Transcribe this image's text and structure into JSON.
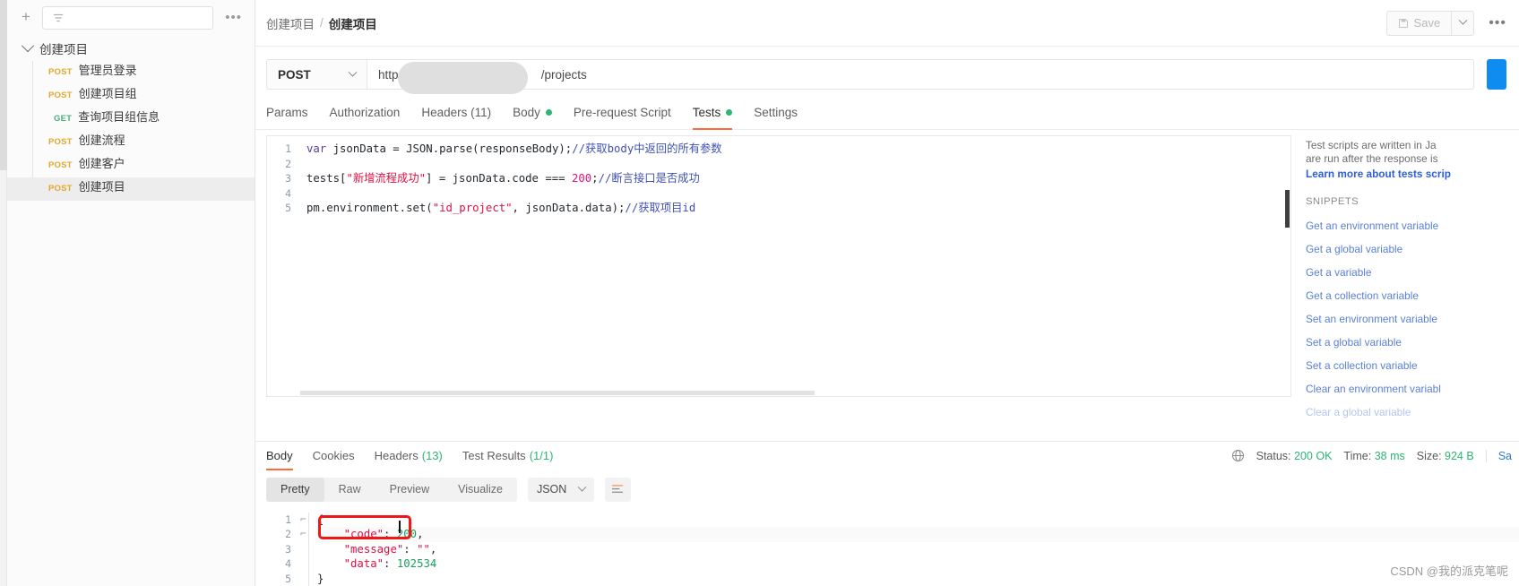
{
  "sidebar": {
    "add_label": "+",
    "filter_placeholder": "",
    "more_label": "•••",
    "collection": "创建项目",
    "requests": [
      {
        "method": "POST",
        "name": "管理员登录"
      },
      {
        "method": "POST",
        "name": "创建项目组"
      },
      {
        "method": "GET",
        "name": "查询项目组信息"
      },
      {
        "method": "POST",
        "name": "创建流程"
      },
      {
        "method": "POST",
        "name": "创建客户"
      },
      {
        "method": "POST",
        "name": "创建项目"
      }
    ]
  },
  "header": {
    "breadcrumb_parent": "创建项目",
    "breadcrumb_sep": "/",
    "breadcrumb_current": "创建项目",
    "save_label": "Save",
    "more_label": "•••"
  },
  "request": {
    "method": "POST",
    "url_prefix": "http://",
    "url_suffix": "/projects",
    "tabs": [
      {
        "label": "Params",
        "dot": false,
        "active": false
      },
      {
        "label": "Authorization",
        "dot": false,
        "active": false
      },
      {
        "label": "Headers (11)",
        "dot": false,
        "active": false
      },
      {
        "label": "Body",
        "dot": true,
        "active": false
      },
      {
        "label": "Pre-request Script",
        "dot": false,
        "active": false
      },
      {
        "label": "Tests",
        "dot": true,
        "active": true
      },
      {
        "label": "Settings",
        "dot": false,
        "active": false
      }
    ]
  },
  "editor": {
    "line_numbers": [
      "1",
      "2",
      "3",
      "4",
      "5"
    ],
    "lines": [
      "var jsonData = JSON.parse(responseBody);//获取body中返回的所有参数",
      "",
      "tests[\"新增流程成功\"] = jsonData.code === 200;//断言接口是否成功",
      "",
      "pm.environment.set(\"id_project\", jsonData.data);//获取项目id"
    ]
  },
  "snippets": {
    "intro_line1": "Test scripts are written in Ja",
    "intro_line2": "are run after the response is",
    "learn_more": "Learn more about tests scrip",
    "heading": "SNIPPETS",
    "items": [
      "Get an environment variable",
      "Get a global variable",
      "Get a variable",
      "Get a collection variable",
      "Set an environment variable",
      "Set a global variable",
      "Set a collection variable",
      "Clear an environment variabl",
      "Clear a global variable"
    ]
  },
  "response": {
    "tabs": [
      {
        "label": "Body",
        "count": "",
        "active": true
      },
      {
        "label": "Cookies",
        "count": "",
        "active": false
      },
      {
        "label": "Headers",
        "count": "(13)",
        "active": false
      },
      {
        "label": "Test Results",
        "count": "(1/1)",
        "active": false
      }
    ],
    "status_label": "Status:",
    "status_value": "200 OK",
    "time_label": "Time:",
    "time_value": "38 ms",
    "size_label": "Size:",
    "size_value": "924 B",
    "save_response": "Sa",
    "format_tabs": [
      "Pretty",
      "Raw",
      "Preview",
      "Visualize"
    ],
    "format_active": "Pretty",
    "language": "JSON",
    "body_line_numbers": [
      "1",
      "2",
      "3",
      "4",
      "5"
    ],
    "body_lines": [
      "{",
      "    \"code\": 200,",
      "    \"message\": \"\",",
      "    \"data\": 102534",
      "}"
    ],
    "body_json": {
      "code": 200,
      "message": "",
      "data": 102534
    }
  },
  "watermark": "CSDN @我的派克笔呢",
  "colors": {
    "accent": "#ff6c37",
    "green": "#2bb673",
    "post": "#e3a82b",
    "get": "#4caf7d",
    "link": "#5a7fd6",
    "highlight_box": "#f01717",
    "send": "#0f8cf0"
  }
}
